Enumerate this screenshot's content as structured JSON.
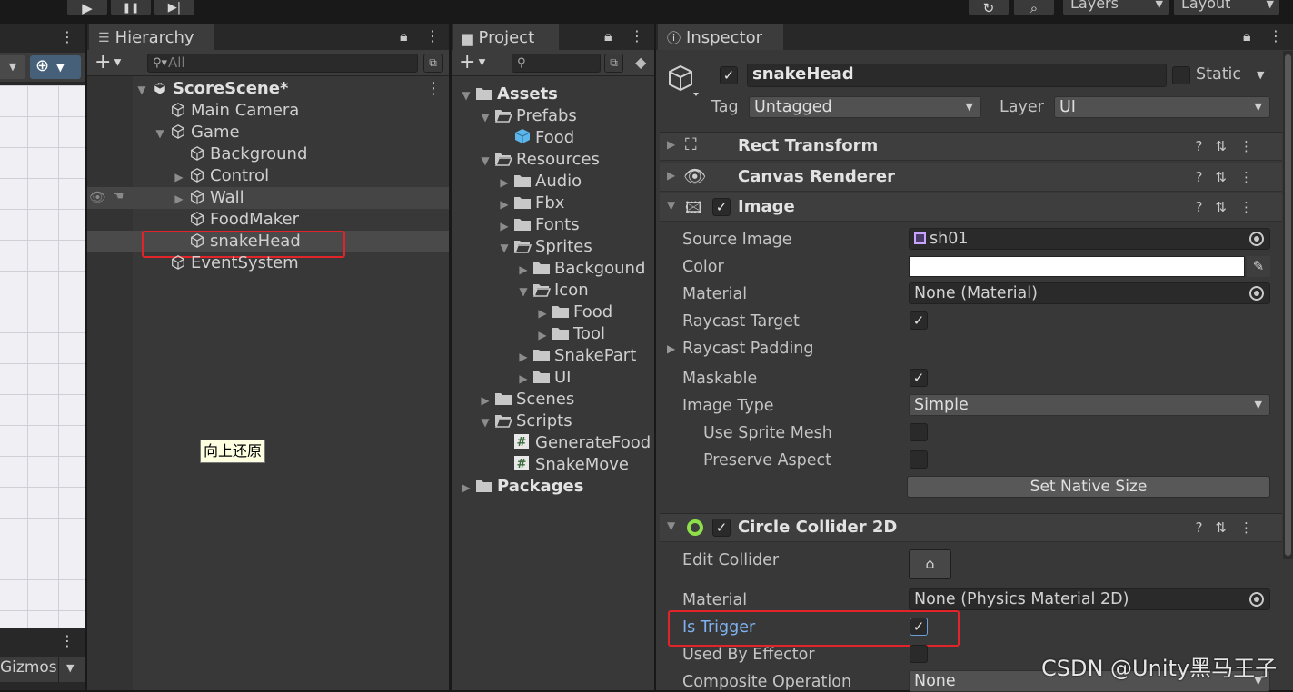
{
  "toolbar": {
    "play": "▶",
    "pause": "❚❚",
    "step": "▶|",
    "layers": "Layers",
    "layout": "Layout"
  },
  "scene": {
    "gizmos": "Gizmos"
  },
  "hierarchy": {
    "tab": "Hierarchy",
    "search_placeholder": "All",
    "scene_name": "ScoreScene*",
    "items": [
      {
        "label": "Main Camera"
      },
      {
        "label": "Game"
      },
      {
        "label": "Background"
      },
      {
        "label": "Control"
      },
      {
        "label": "Wall"
      },
      {
        "label": "FoodMaker"
      },
      {
        "label": "snakeHead"
      },
      {
        "label": "EventSystem"
      }
    ],
    "tooltip": "向上还原"
  },
  "project": {
    "tab": "Project",
    "items": [
      {
        "label": "Assets"
      },
      {
        "label": "Prefabs"
      },
      {
        "label": "Food"
      },
      {
        "label": "Resources"
      },
      {
        "label": "Audio"
      },
      {
        "label": "Fbx"
      },
      {
        "label": "Fonts"
      },
      {
        "label": "Sprites"
      },
      {
        "label": "Backgound"
      },
      {
        "label": "Icon"
      },
      {
        "label": "Food"
      },
      {
        "label": "Tool"
      },
      {
        "label": "SnakePart"
      },
      {
        "label": "UI"
      },
      {
        "label": "Scenes"
      },
      {
        "label": "Scripts"
      },
      {
        "label": "GenerateFood"
      },
      {
        "label": "SnakeMove"
      },
      {
        "label": "Packages"
      }
    ]
  },
  "inspector": {
    "tab": "Inspector",
    "object_name": "snakeHead",
    "static_label": "Static",
    "tag_label": "Tag",
    "tag_value": "Untagged",
    "layer_label": "Layer",
    "layer_value": "UI",
    "components": {
      "rect_transform": "Rect Transform",
      "canvas_renderer": "Canvas Renderer",
      "image": "Image",
      "circle_collider": "Circle Collider 2D"
    },
    "image": {
      "source_image_label": "Source Image",
      "source_image_value": "sh01",
      "color_label": "Color",
      "material_label": "Material",
      "material_value": "None (Material)",
      "raycast_target_label": "Raycast Target",
      "raycast_padding_label": "Raycast Padding",
      "maskable_label": "Maskable",
      "image_type_label": "Image Type",
      "image_type_value": "Simple",
      "use_sprite_mesh_label": "Use Sprite Mesh",
      "preserve_aspect_label": "Preserve Aspect",
      "set_native_size": "Set Native Size"
    },
    "collider": {
      "edit_collider_label": "Edit Collider",
      "material_label": "Material",
      "material_value": "None (Physics Material 2D)",
      "is_trigger_label": "Is Trigger",
      "used_by_effector_label": "Used By Effector",
      "composite_operation_label": "Composite Operation",
      "composite_operation_value": "None"
    },
    "colors": {
      "highlight_box": "#e0242a",
      "is_trigger_text": "#7fb2f0"
    }
  },
  "watermark": "CSDN @Unity黑马王子"
}
